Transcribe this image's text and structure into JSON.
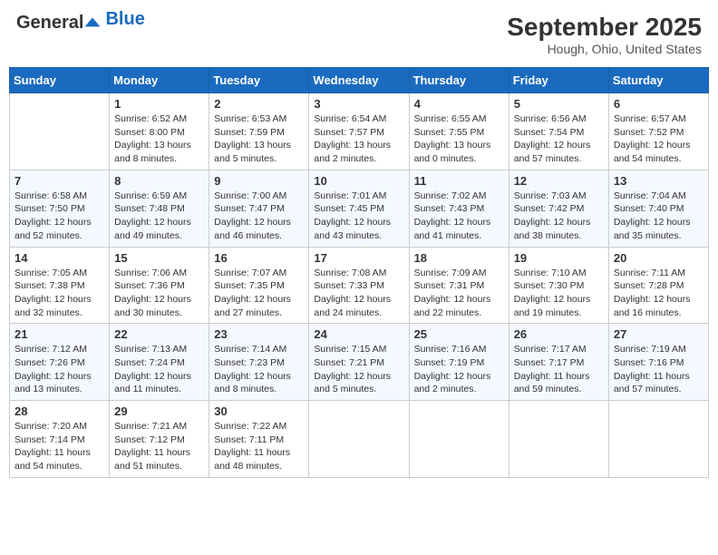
{
  "header": {
    "logo_general": "General",
    "logo_blue": "Blue",
    "title": "September 2025",
    "subtitle": "Hough, Ohio, United States"
  },
  "days_of_week": [
    "Sunday",
    "Monday",
    "Tuesday",
    "Wednesday",
    "Thursday",
    "Friday",
    "Saturday"
  ],
  "weeks": [
    [
      {
        "day": "",
        "info": ""
      },
      {
        "day": "1",
        "info": "Sunrise: 6:52 AM\nSunset: 8:00 PM\nDaylight: 13 hours\nand 8 minutes."
      },
      {
        "day": "2",
        "info": "Sunrise: 6:53 AM\nSunset: 7:59 PM\nDaylight: 13 hours\nand 5 minutes."
      },
      {
        "day": "3",
        "info": "Sunrise: 6:54 AM\nSunset: 7:57 PM\nDaylight: 13 hours\nand 2 minutes."
      },
      {
        "day": "4",
        "info": "Sunrise: 6:55 AM\nSunset: 7:55 PM\nDaylight: 13 hours\nand 0 minutes."
      },
      {
        "day": "5",
        "info": "Sunrise: 6:56 AM\nSunset: 7:54 PM\nDaylight: 12 hours\nand 57 minutes."
      },
      {
        "day": "6",
        "info": "Sunrise: 6:57 AM\nSunset: 7:52 PM\nDaylight: 12 hours\nand 54 minutes."
      }
    ],
    [
      {
        "day": "7",
        "info": "Sunrise: 6:58 AM\nSunset: 7:50 PM\nDaylight: 12 hours\nand 52 minutes."
      },
      {
        "day": "8",
        "info": "Sunrise: 6:59 AM\nSunset: 7:48 PM\nDaylight: 12 hours\nand 49 minutes."
      },
      {
        "day": "9",
        "info": "Sunrise: 7:00 AM\nSunset: 7:47 PM\nDaylight: 12 hours\nand 46 minutes."
      },
      {
        "day": "10",
        "info": "Sunrise: 7:01 AM\nSunset: 7:45 PM\nDaylight: 12 hours\nand 43 minutes."
      },
      {
        "day": "11",
        "info": "Sunrise: 7:02 AM\nSunset: 7:43 PM\nDaylight: 12 hours\nand 41 minutes."
      },
      {
        "day": "12",
        "info": "Sunrise: 7:03 AM\nSunset: 7:42 PM\nDaylight: 12 hours\nand 38 minutes."
      },
      {
        "day": "13",
        "info": "Sunrise: 7:04 AM\nSunset: 7:40 PM\nDaylight: 12 hours\nand 35 minutes."
      }
    ],
    [
      {
        "day": "14",
        "info": "Sunrise: 7:05 AM\nSunset: 7:38 PM\nDaylight: 12 hours\nand 32 minutes."
      },
      {
        "day": "15",
        "info": "Sunrise: 7:06 AM\nSunset: 7:36 PM\nDaylight: 12 hours\nand 30 minutes."
      },
      {
        "day": "16",
        "info": "Sunrise: 7:07 AM\nSunset: 7:35 PM\nDaylight: 12 hours\nand 27 minutes."
      },
      {
        "day": "17",
        "info": "Sunrise: 7:08 AM\nSunset: 7:33 PM\nDaylight: 12 hours\nand 24 minutes."
      },
      {
        "day": "18",
        "info": "Sunrise: 7:09 AM\nSunset: 7:31 PM\nDaylight: 12 hours\nand 22 minutes."
      },
      {
        "day": "19",
        "info": "Sunrise: 7:10 AM\nSunset: 7:30 PM\nDaylight: 12 hours\nand 19 minutes."
      },
      {
        "day": "20",
        "info": "Sunrise: 7:11 AM\nSunset: 7:28 PM\nDaylight: 12 hours\nand 16 minutes."
      }
    ],
    [
      {
        "day": "21",
        "info": "Sunrise: 7:12 AM\nSunset: 7:26 PM\nDaylight: 12 hours\nand 13 minutes."
      },
      {
        "day": "22",
        "info": "Sunrise: 7:13 AM\nSunset: 7:24 PM\nDaylight: 12 hours\nand 11 minutes."
      },
      {
        "day": "23",
        "info": "Sunrise: 7:14 AM\nSunset: 7:23 PM\nDaylight: 12 hours\nand 8 minutes."
      },
      {
        "day": "24",
        "info": "Sunrise: 7:15 AM\nSunset: 7:21 PM\nDaylight: 12 hours\nand 5 minutes."
      },
      {
        "day": "25",
        "info": "Sunrise: 7:16 AM\nSunset: 7:19 PM\nDaylight: 12 hours\nand 2 minutes."
      },
      {
        "day": "26",
        "info": "Sunrise: 7:17 AM\nSunset: 7:17 PM\nDaylight: 11 hours\nand 59 minutes."
      },
      {
        "day": "27",
        "info": "Sunrise: 7:19 AM\nSunset: 7:16 PM\nDaylight: 11 hours\nand 57 minutes."
      }
    ],
    [
      {
        "day": "28",
        "info": "Sunrise: 7:20 AM\nSunset: 7:14 PM\nDaylight: 11 hours\nand 54 minutes."
      },
      {
        "day": "29",
        "info": "Sunrise: 7:21 AM\nSunset: 7:12 PM\nDaylight: 11 hours\nand 51 minutes."
      },
      {
        "day": "30",
        "info": "Sunrise: 7:22 AM\nSunset: 7:11 PM\nDaylight: 11 hours\nand 48 minutes."
      },
      {
        "day": "",
        "info": ""
      },
      {
        "day": "",
        "info": ""
      },
      {
        "day": "",
        "info": ""
      },
      {
        "day": "",
        "info": ""
      }
    ]
  ]
}
